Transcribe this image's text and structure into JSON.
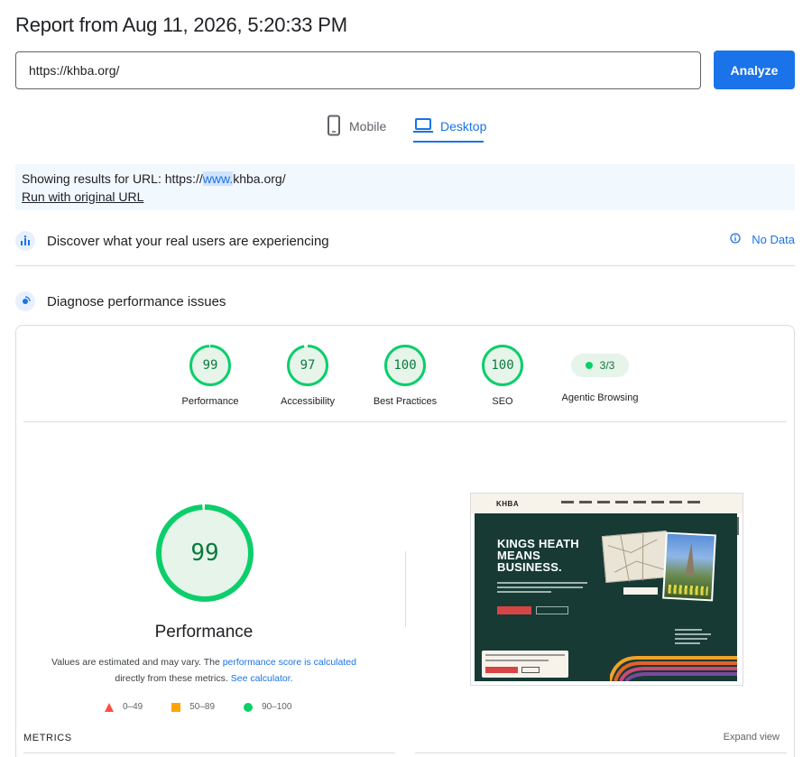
{
  "report": {
    "title": "Report from Aug 11, 2026, 5:20:33 PM"
  },
  "search": {
    "url_value": "https://khba.org/",
    "analyze_label": "Analyze"
  },
  "tabs": [
    {
      "label": "Mobile",
      "icon": "smartphone-icon",
      "active": false
    },
    {
      "label": "Desktop",
      "icon": "laptop-icon",
      "active": true
    }
  ],
  "notice": {
    "prefix": "Showing results for URL: https://",
    "highlight": "www.",
    "suffix": "khba.org/",
    "run_link": "Run with original URL"
  },
  "field_data": {
    "title": "Discover what your real users are experiencing",
    "status": "No Data",
    "icon": "users-chart-icon",
    "status_icon": "info-icon"
  },
  "lab_data": {
    "title": "Diagnose performance issues",
    "icon": "lighthouse-icon"
  },
  "scores": [
    {
      "label": "Performance",
      "value": "99",
      "fraction": 0.99
    },
    {
      "label": "Accessibility",
      "value": "97",
      "fraction": 0.97
    },
    {
      "label": "Best Practices",
      "value": "100",
      "fraction": 1.0
    },
    {
      "label": "SEO",
      "value": "100",
      "fraction": 1.0
    }
  ],
  "agentic": {
    "label": "Agentic Browsing",
    "value": "3/3"
  },
  "main_score": {
    "value": "99",
    "fraction": 0.99,
    "label": "Performance",
    "estimate_text_1": "Values are estimated and may vary. The ",
    "estimate_link_1": "performance score is calculated",
    "estimate_text_2": "directly from these metrics. ",
    "estimate_link_2": "See calculator."
  },
  "legend": [
    {
      "range": "0–49",
      "color": "#ff4e42",
      "shape": "triangle"
    },
    {
      "range": "50–89",
      "color": "#ffa400",
      "shape": "square"
    },
    {
      "range": "90–100",
      "color": "#0cce6b",
      "shape": "circle"
    }
  ],
  "metrics": {
    "heading": "METRICS",
    "expand_label": "Expand view"
  },
  "thumbnail": {
    "logo": "KHBA",
    "hero_line_1": "KINGS HEATH",
    "hero_line_2": "MEANS",
    "hero_line_3": "BUSINESS."
  },
  "colors": {
    "accent": "#1a73e8",
    "pass": "#0cce6b",
    "pass_text": "#0a7a3d",
    "pass_bg": "#e6f4ea"
  }
}
